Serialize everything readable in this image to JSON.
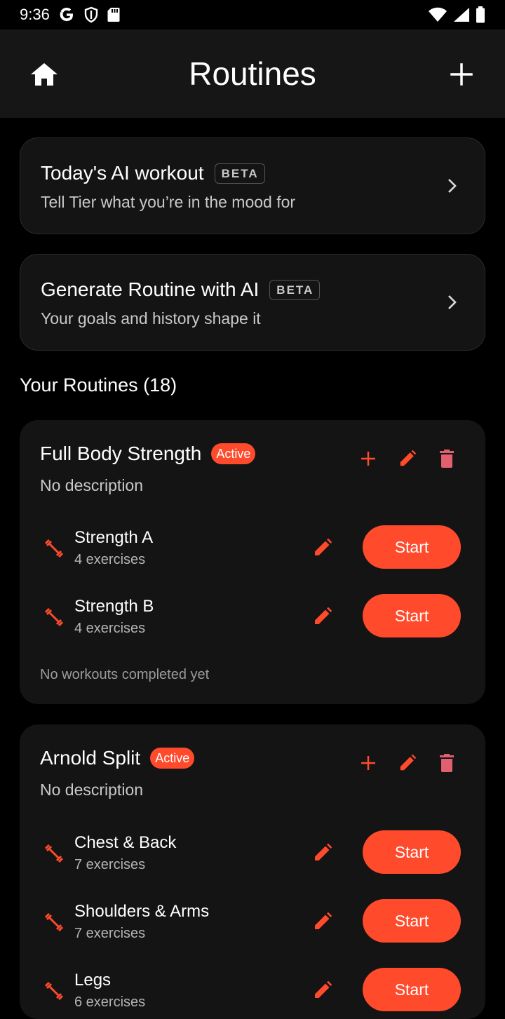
{
  "status_bar": {
    "time": "9:36"
  },
  "app_bar": {
    "title": "Routines"
  },
  "ai_cards": [
    {
      "title": "Today's AI workout",
      "badge": "BETA",
      "subtitle": "Tell Tier what you’re in the mood for"
    },
    {
      "title": "Generate Routine with AI",
      "badge": "BETA",
      "subtitle": "Your goals and history shape it"
    }
  ],
  "section": {
    "title": "Your Routines (18)"
  },
  "routines": [
    {
      "name": "Full Body Strength",
      "badge": "Active",
      "description": "No description",
      "workouts": [
        {
          "name": "Strength A",
          "count": "4 exercises",
          "start": "Start"
        },
        {
          "name": "Strength B",
          "count": "4 exercises",
          "start": "Start"
        }
      ],
      "footer": "No workouts completed yet"
    },
    {
      "name": "Arnold Split",
      "badge": "Active",
      "description": "No description",
      "workouts": [
        {
          "name": "Chest & Back",
          "count": "7 exercises",
          "start": "Start"
        },
        {
          "name": "Shoulders & Arms",
          "count": "7 exercises",
          "start": "Start"
        },
        {
          "name": "Legs",
          "count": "6 exercises",
          "start": "Start"
        }
      ]
    }
  ],
  "colors": {
    "accent": "#ff4a2b",
    "delete": "#e06070",
    "card": "#141414",
    "appbar": "#161616"
  }
}
